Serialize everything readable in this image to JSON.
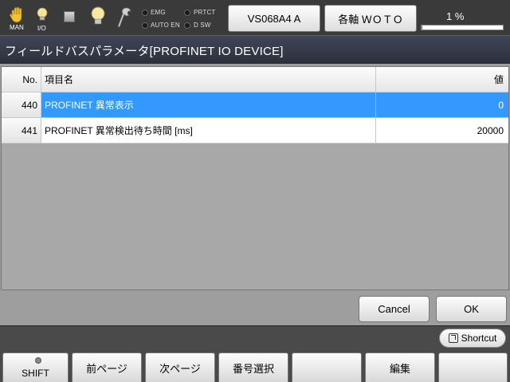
{
  "status": {
    "mode_label": "MAN",
    "io_label": "I/O",
    "indicators": {
      "emg": "EMG",
      "prtct": "PRTCT",
      "auto_en": "AUTO EN",
      "d_sw": "D SW"
    },
    "program_button": "VS068A4 A",
    "axis_button": "各軸 ＷＯＴＯ",
    "progress_text": "1 %",
    "progress_fraction": 0.01
  },
  "title": "フィールドバスパラメータ[PROFINET IO DEVICE]",
  "table": {
    "headers": {
      "no": "No.",
      "name": "項目名",
      "value": "値"
    },
    "rows": [
      {
        "no": "440",
        "name": "PROFINET 異常表示",
        "value": "0",
        "selected": true
      },
      {
        "no": "441",
        "name": "PROFINET 異常検出待ち時間 [ms]",
        "value": "20000",
        "selected": false
      }
    ]
  },
  "dialog": {
    "cancel": "Cancel",
    "ok": "OK"
  },
  "shortcut_label": "Shortcut",
  "function_keys": [
    "SHIFT",
    "前ページ",
    "次ページ",
    "番号選択",
    "",
    "編集",
    ""
  ],
  "colors": {
    "selection": "#3399ff",
    "title_bar": "#363b47",
    "progress": "#3b8ee8"
  },
  "icons": [
    "hand-icon",
    "bulb-icon",
    "stop-icon",
    "bulb-icon",
    "wrench-icon",
    "shortcut-icon"
  ]
}
